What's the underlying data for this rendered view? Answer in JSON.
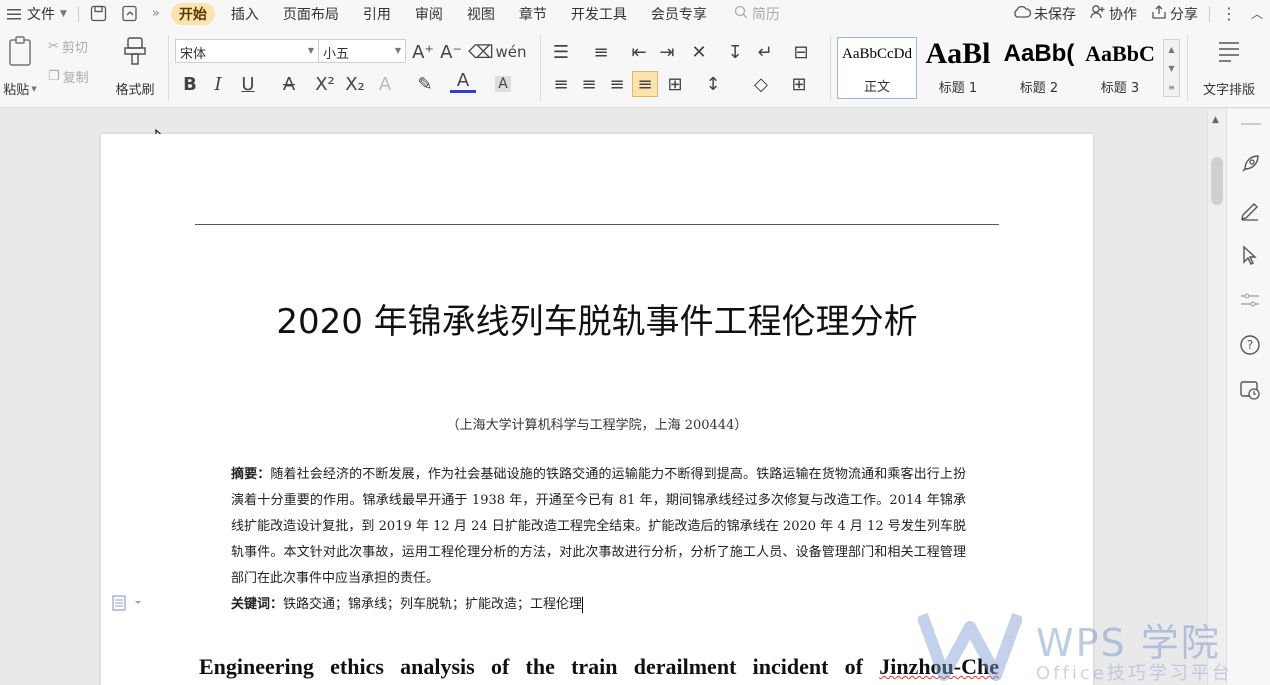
{
  "menu": {
    "file_label": "文件",
    "tabs": [
      "开始",
      "插入",
      "页面布局",
      "引用",
      "审阅",
      "视图",
      "章节",
      "开发工具",
      "会员专享"
    ],
    "active_tab": "开始",
    "search_label": "简历",
    "unsaved_label": "未保存",
    "collab_label": "协作",
    "share_label": "分享"
  },
  "ribbon": {
    "paste_label": "粘贴",
    "cut_label": "剪切",
    "copy_label": "复制",
    "format_painter_label": "格式刷",
    "font_name": "宋体",
    "font_size": "小五",
    "styles": [
      {
        "preview": "AaBbCcDd",
        "label": "正文"
      },
      {
        "preview": "AaBl",
        "label": "标题 1"
      },
      {
        "preview": "AaBb(",
        "label": "标题 2"
      },
      {
        "preview": "AaBbC",
        "label": "标题 3"
      }
    ],
    "text_layout_label": "文字排版"
  },
  "document": {
    "title": "2020 年锦承线列车脱轨事件工程伦理分析",
    "affiliation": "（上海大学计算机科学与工程学院，上海 200444）",
    "abstract_label": "摘要：",
    "abstract_text": "随着社会经济的不断发展，作为社会基础设施的铁路交通的运输能力不断得到提高。铁路运输在货物流通和乘客出行上扮演着十分重要的作用。锦承线最早开通于 1938 年，开通至今已有 81 年，期间锦承线经过多次修复与改造工作。2014 年锦承线扩能改造设计复批，到 2019 年 12 月 24 日扩能改造工程完全结束。扩能改造后的锦承线在 2020 年 4 月 12 号发生列车脱轨事件。本文针对此次事故，运用工程伦理分析的方法，对此次事故进行分析，分析了施工人员、设备管理部门和相关工程管理部门在此次事件中应当承担的责任。",
    "keywords_label": "关键词：",
    "keywords_text": "铁路交通；锦承线；列车脱轨；扩能改造；工程伦理",
    "english_title_prefix": "Engineering ethics analysis of the train derailment incident of ",
    "english_title_squiggle": "Jinzhou-Che"
  },
  "watermark": {
    "brand": "WPS 学院",
    "tagline": "Office技巧学习平台"
  },
  "colors": {
    "active_tab_bg": "#fbe3b0",
    "accent_blue": "#2b579a",
    "spell_error": "#e33"
  }
}
